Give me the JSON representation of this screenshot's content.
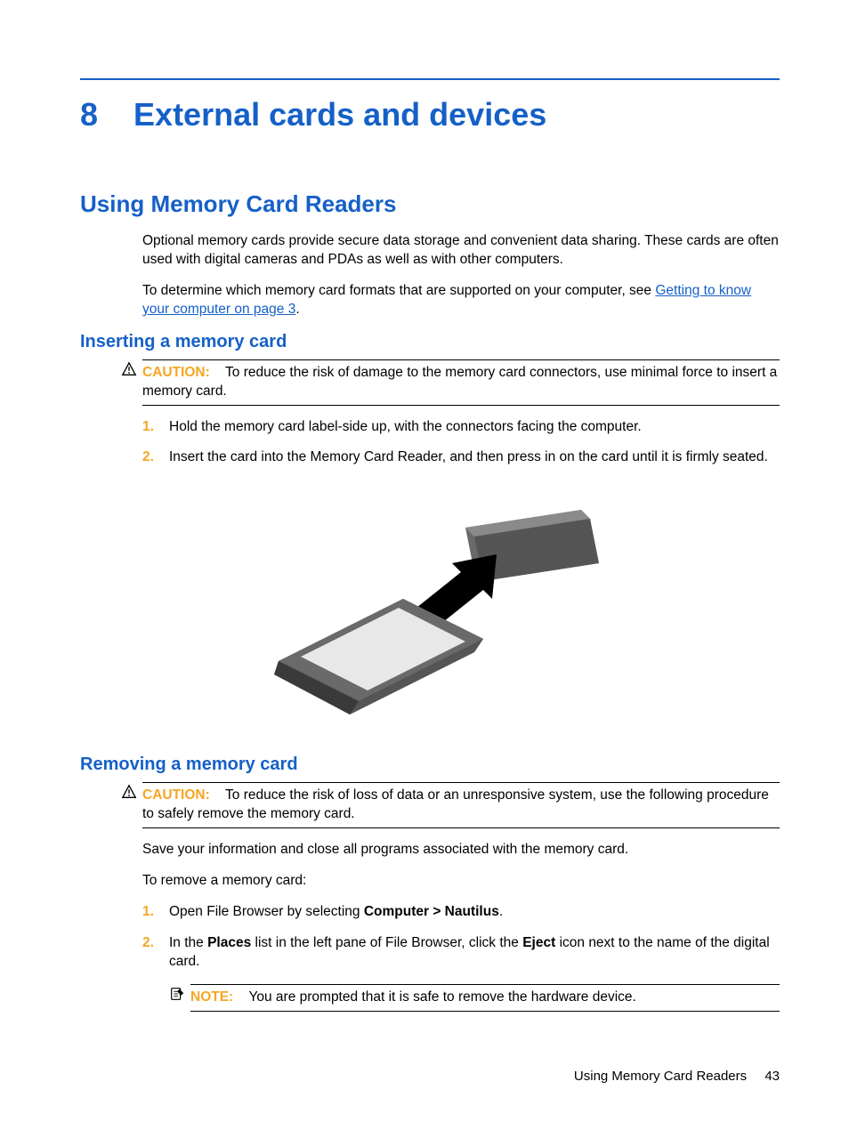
{
  "chapter": {
    "number": "8",
    "title": "External cards and devices"
  },
  "section1": {
    "heading": "Using Memory Card Readers",
    "para1": "Optional memory cards provide secure data storage and convenient data sharing. These cards are often used with digital cameras and PDAs as well as with other computers.",
    "para2_pre": "To determine which memory card formats that are supported on your computer, see ",
    "para2_link": "Getting to know your computer on page 3",
    "para2_post": "."
  },
  "insert": {
    "heading": "Inserting a memory card",
    "caution_label": "CAUTION:",
    "caution_text": "To reduce the risk of damage to the memory card connectors, use minimal force to insert a memory card.",
    "steps": [
      "Hold the memory card label-side up, with the connectors facing the computer.",
      "Insert the card into the Memory Card Reader, and then press in on the card until it is firmly seated."
    ],
    "step_nums": [
      "1.",
      "2."
    ]
  },
  "remove": {
    "heading": "Removing a memory card",
    "caution_label": "CAUTION:",
    "caution_text": "To reduce the risk of loss of data or an unresponsive system, use the following procedure to safely remove the memory card.",
    "para1": "Save your information and close all programs associated with the memory card.",
    "para2": "To remove a memory card:",
    "step_nums": [
      "1.",
      "2."
    ],
    "step1_pre": "Open File Browser by selecting ",
    "step1_bold": "Computer > Nautilus",
    "step1_post": ".",
    "step2_pre": "In the ",
    "step2_bold1": "Places",
    "step2_mid": " list in the left pane of File Browser, click the ",
    "step2_bold2": "Eject",
    "step2_post": " icon next to the name of the digital card.",
    "note_label": "NOTE:",
    "note_text": "You are prompted that it is safe to remove the hardware device."
  },
  "footer": {
    "section": "Using Memory Card Readers",
    "page": "43"
  }
}
